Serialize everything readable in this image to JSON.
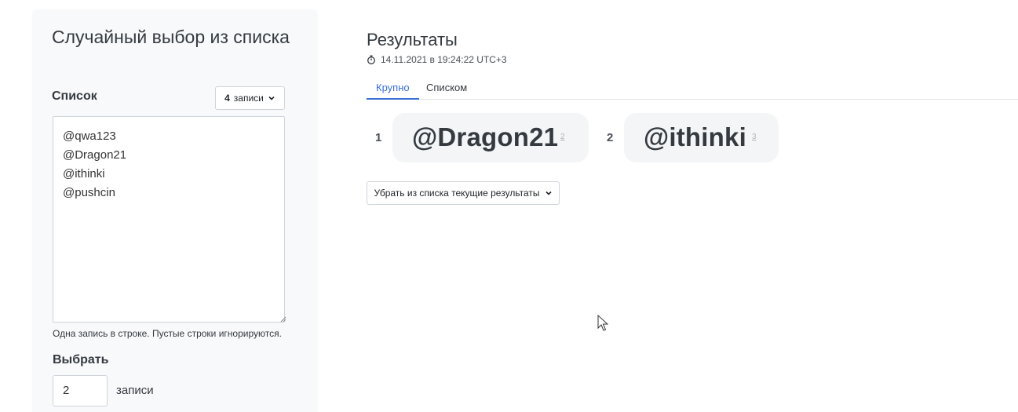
{
  "left_panel": {
    "title": "Случайный выбор из списка",
    "list_label": "Список",
    "count_dropdown": {
      "number": "4",
      "unit": "записи"
    },
    "list_text": "@qwa123\n@Dragon21\n@ithinki\n@pushcin",
    "hint": "Одна запись в строке. Пустые строки игнорируются.",
    "choose_label": "Выбрать",
    "choose_value": "2",
    "choose_unit": "записи"
  },
  "results": {
    "title": "Результаты",
    "timestamp": "14.11.2021 в 19:24:22 UTC+3",
    "tabs": [
      {
        "label": "Крупно",
        "active": true
      },
      {
        "label": "Списком",
        "active": false
      }
    ],
    "items": [
      {
        "rank": "1",
        "name": "@Dragon21",
        "index": "2"
      },
      {
        "rank": "2",
        "name": "@ithinki",
        "index": "3"
      }
    ],
    "remove_button": "Убрать из списка текущие результаты"
  },
  "colors": {
    "accent": "#3a6fd8",
    "panel_bg": "#f8f9fa",
    "pill_bg": "#f4f5f6"
  }
}
